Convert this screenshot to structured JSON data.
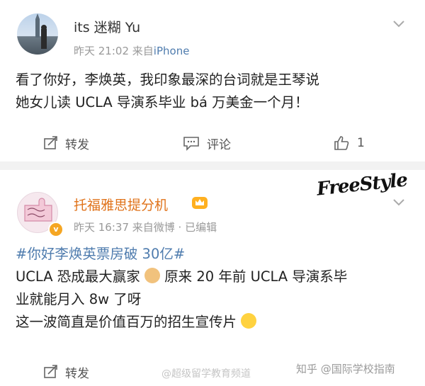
{
  "post1": {
    "username": "its 迷糊 Yu",
    "time": "昨天 21:02",
    "source_prefix": "来自",
    "source": "iPhone",
    "text_line1": "看了你好，李焕英，我印象最深的台词就是王琴说",
    "text_line2": "她女儿读 UCLA 导演系毕业 bá 万美金一个月！",
    "actions": {
      "repost": "转发",
      "comment": "评论",
      "like_count": "1"
    }
  },
  "post2": {
    "username": "托福雅思提分机",
    "time": "昨天 16:37",
    "source": "来自微博 ·",
    "edited": "已编辑",
    "hashtag": "#你好李焕英票房破 30亿#",
    "line2_a": "UCLA 恐成最大赢家",
    "line2_b": "原来 20 年前 UCLA 导演系毕",
    "line3": "业就能月入 8w 了呀",
    "line4": "这一波简直是价值百万的招生宣传片",
    "actions": {
      "repost": "转发"
    },
    "stamp": "FreeStyle"
  },
  "watermarks": {
    "weibo": "@超级留学教育频道",
    "zhihu": "知乎 @国际学校指南"
  },
  "icons": [
    "chevron-down-icon",
    "repost-icon",
    "comment-icon",
    "like-icon",
    "crown-badge-icon",
    "verified-badge-icon",
    "doge-emoji-icon",
    "laugh-cry-emoji-icon"
  ],
  "colors": {
    "link": "#4f7cae",
    "username_orange": "#e0731b",
    "meta": "#999999"
  }
}
